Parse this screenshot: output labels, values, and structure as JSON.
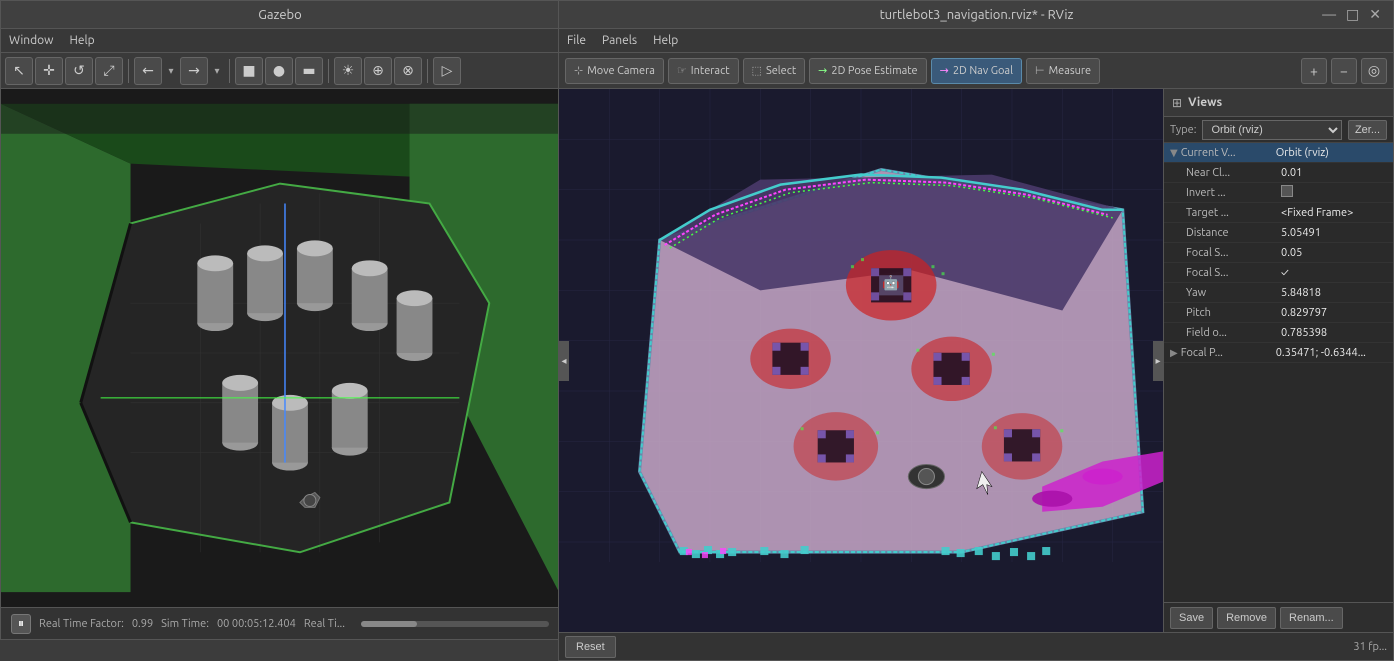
{
  "gazebo": {
    "title": "Gazebo",
    "menu": {
      "window": "Window",
      "help": "Help"
    },
    "statusbar": {
      "rtf_label": "Real Time Factor:",
      "rtf_value": "0.99",
      "sim_label": "Sim Time:",
      "sim_value": "00 00:05:12.404",
      "real_label": "Real Ti..."
    },
    "toolbar": {
      "tools": [
        "↖",
        "✛",
        "↺",
        "⤢",
        "←",
        "→",
        "■",
        "●",
        "▬",
        "☀",
        "⊕",
        "⊗",
        "▷"
      ]
    }
  },
  "rviz": {
    "title": "turtlebot3_navigation.rviz* - RViz",
    "title_controls": [
      "—",
      "□",
      "×"
    ],
    "menu": {
      "file": "File",
      "panels": "Panels",
      "help": "Help"
    },
    "toolbar": {
      "move_camera": "Move Camera",
      "interact": "Interact",
      "select": "Select",
      "pose_estimate": "2D Pose Estimate",
      "nav_goal": "2D Nav Goal",
      "measure": "Measure",
      "icons": [
        "+",
        "−",
        "◎"
      ]
    },
    "views_panel": {
      "title": "Views",
      "type_label": "Type:",
      "type_value": "Orbit (rviz)",
      "zero_btn": "Zer...",
      "tree": {
        "header_name": "Current V...",
        "header_value": "Orbit (rviz)",
        "rows": [
          {
            "name": "Near Cl...",
            "value": "0.01",
            "indent": 1,
            "has_expand": false
          },
          {
            "name": "Invert ...",
            "value": "",
            "indent": 1,
            "has_checkbox": true
          },
          {
            "name": "Target ...",
            "value": "<Fixed Frame>",
            "indent": 1
          },
          {
            "name": "Distance",
            "value": "5.05491",
            "indent": 1
          },
          {
            "name": "Focal S...",
            "value": "0.05",
            "indent": 1
          },
          {
            "name": "Focal S...",
            "value": "✓",
            "indent": 1
          },
          {
            "name": "Yaw",
            "value": "5.84818",
            "indent": 1
          },
          {
            "name": "Pitch",
            "value": "0.829797",
            "indent": 1
          },
          {
            "name": "Field o...",
            "value": "0.785398",
            "indent": 1
          },
          {
            "name": "Focal P...",
            "value": "0.35471; -0.6344...",
            "indent": 1,
            "has_expand": true
          }
        ]
      },
      "footer_buttons": [
        "Save",
        "Remove",
        "Renam..."
      ]
    },
    "statusbar": {
      "fps": "31 fp..."
    },
    "bottom_bar": {
      "reset_btn": "Reset"
    }
  }
}
